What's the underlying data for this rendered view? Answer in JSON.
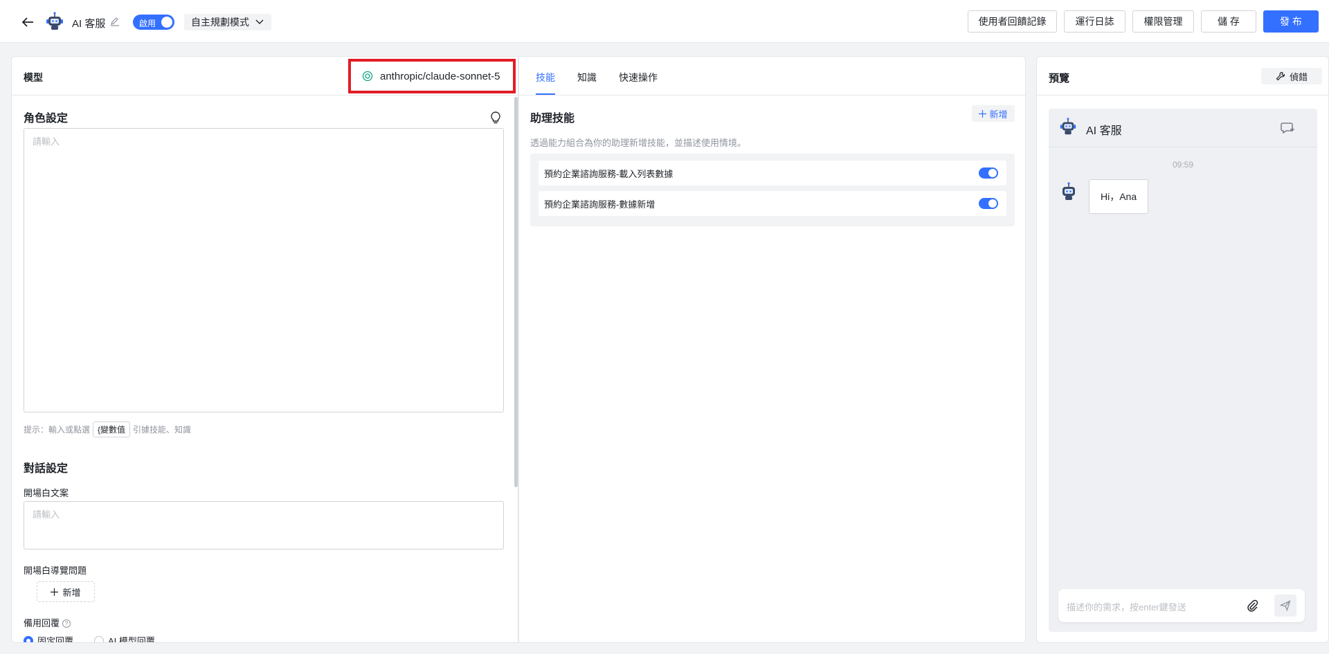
{
  "header": {
    "app_name": "AI 客服",
    "toggle_label": "啟用",
    "mode_label": "自主規劃模式",
    "buttons": [
      "使用者回饋記錄",
      "運行日誌",
      "權限管理",
      "儲 存",
      "發 布"
    ]
  },
  "left": {
    "title": "模型",
    "model_name": "anthropic/claude-sonnet-5",
    "role_title": "角色設定",
    "role_placeholder": "請輸入",
    "hint_prefix": "提示：輸入或點選",
    "hint_chip": "{變數值",
    "hint_suffix": "引據技能、知識",
    "dialog_title": "對話設定",
    "opening_label": "開場白文案",
    "opening_placeholder": "請輸入",
    "guide_label": "開場白導覽問題",
    "add_label": "新增",
    "fallback_label": "備用回覆",
    "radio_fixed": "固定回覆",
    "radio_ai": "AI 模型回覆"
  },
  "middle": {
    "tabs": [
      "技能",
      "知識",
      "快速操作"
    ],
    "section_title": "助理技能",
    "add_label": "新增",
    "description": "透過能力組合為你的助理新增技能，並描述使用情境。",
    "skills": [
      {
        "name": "預約企業諮詢服務-載入列表數據",
        "enabled": true
      },
      {
        "name": "預約企業諮詢服務-數據新增",
        "enabled": true
      }
    ]
  },
  "right": {
    "title": "預覽",
    "debug_label": "偵錯",
    "chat_title": "AI 客服",
    "time": "09:59",
    "greeting": "Hi，Ana",
    "input_placeholder": "描述你的需求，按enter鍵發送"
  },
  "colors": {
    "accent": "#3370ff",
    "highlight_border": "#e11d26"
  }
}
